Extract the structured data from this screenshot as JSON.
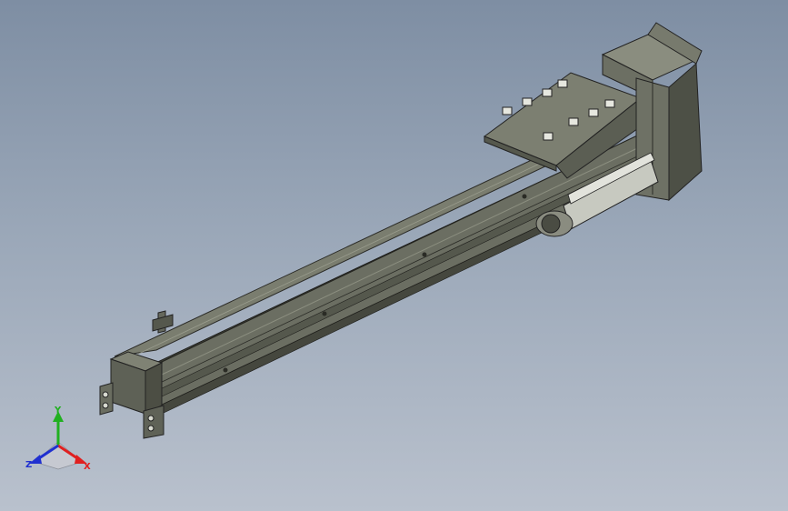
{
  "viewport": {
    "background_top": "#7e8ea3",
    "background_bottom": "#b9c1cd",
    "model": "linear-actuator-with-motor"
  },
  "triad": {
    "x_label": "X",
    "y_label": "Y",
    "z_label": "Z",
    "colors": {
      "x": "#e02020",
      "y": "#20b020",
      "z": "#2030d0"
    }
  }
}
